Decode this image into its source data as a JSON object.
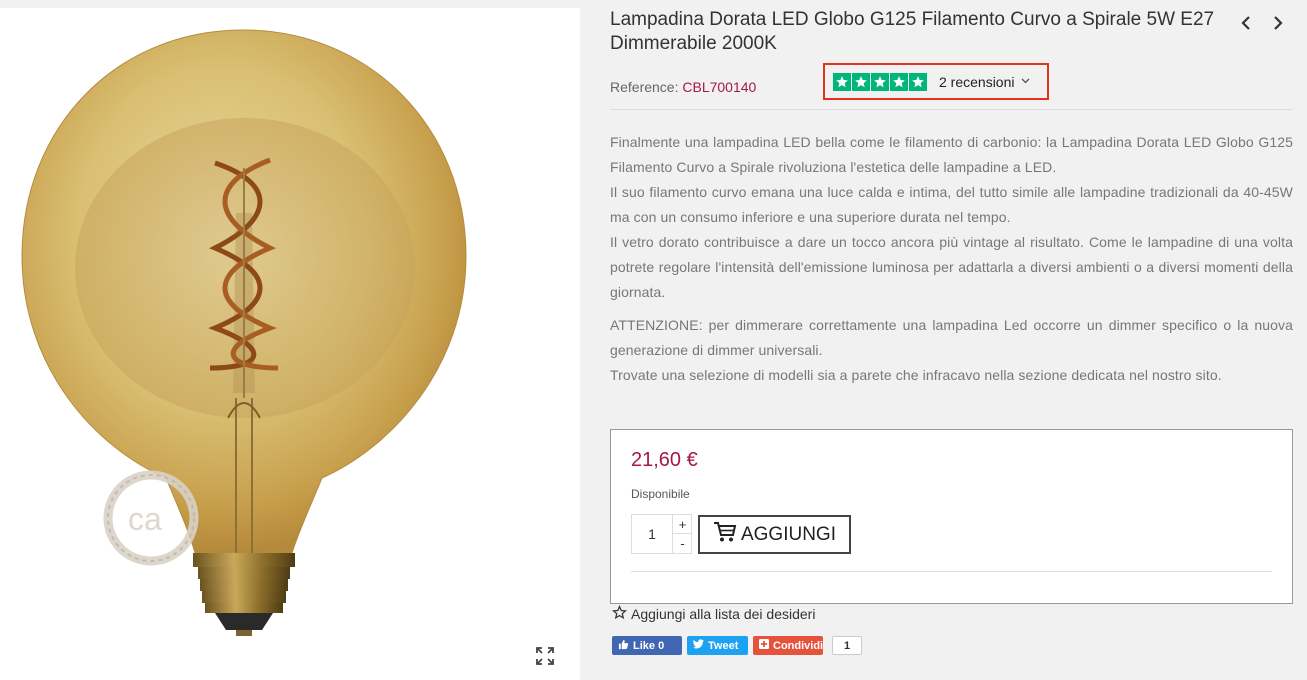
{
  "product": {
    "title": "Lampadina Dorata LED Globo G125 Filamento Curvo a Spirale 5W E27 Dimmerabile 2000K",
    "reference_label": "Reference:",
    "reference_value": "CBL700140",
    "logo_text": "ca"
  },
  "reviews": {
    "stars": 5,
    "label": "2 recensioni",
    "star_color": "#00b67a"
  },
  "description": {
    "p1": "Finalmente una lampadina LED bella come le filamento di carbonio: la Lampadina Dorata LED Globo G125 Filamento Curvo a Spirale rivoluziona l'estetica delle lampadine a LED.",
    "p2": "Il suo filamento curvo emana una luce calda e intima, del tutto simile alle lampadine tradizionali da 40-45W ma con un consumo inferiore e una superiore durata nel tempo.",
    "p3": "Il vetro dorato contribuisce a dare un tocco ancora più vintage al risultato. Come le lampadine di una volta potrete regolare l'intensità dell'emissione luminosa per adattarla a diversi ambienti o a diversi momenti della giornata.",
    "p4": "ATTENZIONE: per dimmerare correttamente una lampadina Led occorre un dimmer specifico o la nuova generazione di dimmer universali.",
    "p5": "Trovate una selezione di modelli sia a parete che infracavo nella sezione dedicata nel nostro sito."
  },
  "buy": {
    "price": "21,60 €",
    "availability": "Disponibile",
    "quantity": "1",
    "plus": "+",
    "minus": "-",
    "add_label": "AGGIUNGI"
  },
  "wishlist": {
    "label": "Aggiungi alla lista dei desideri"
  },
  "social": {
    "facebook": "Like 0",
    "twitter": "Tweet",
    "share": "Condividi",
    "share_count": "1"
  },
  "colors": {
    "accent": "#a3184d",
    "review_highlight": "#e1341e"
  }
}
